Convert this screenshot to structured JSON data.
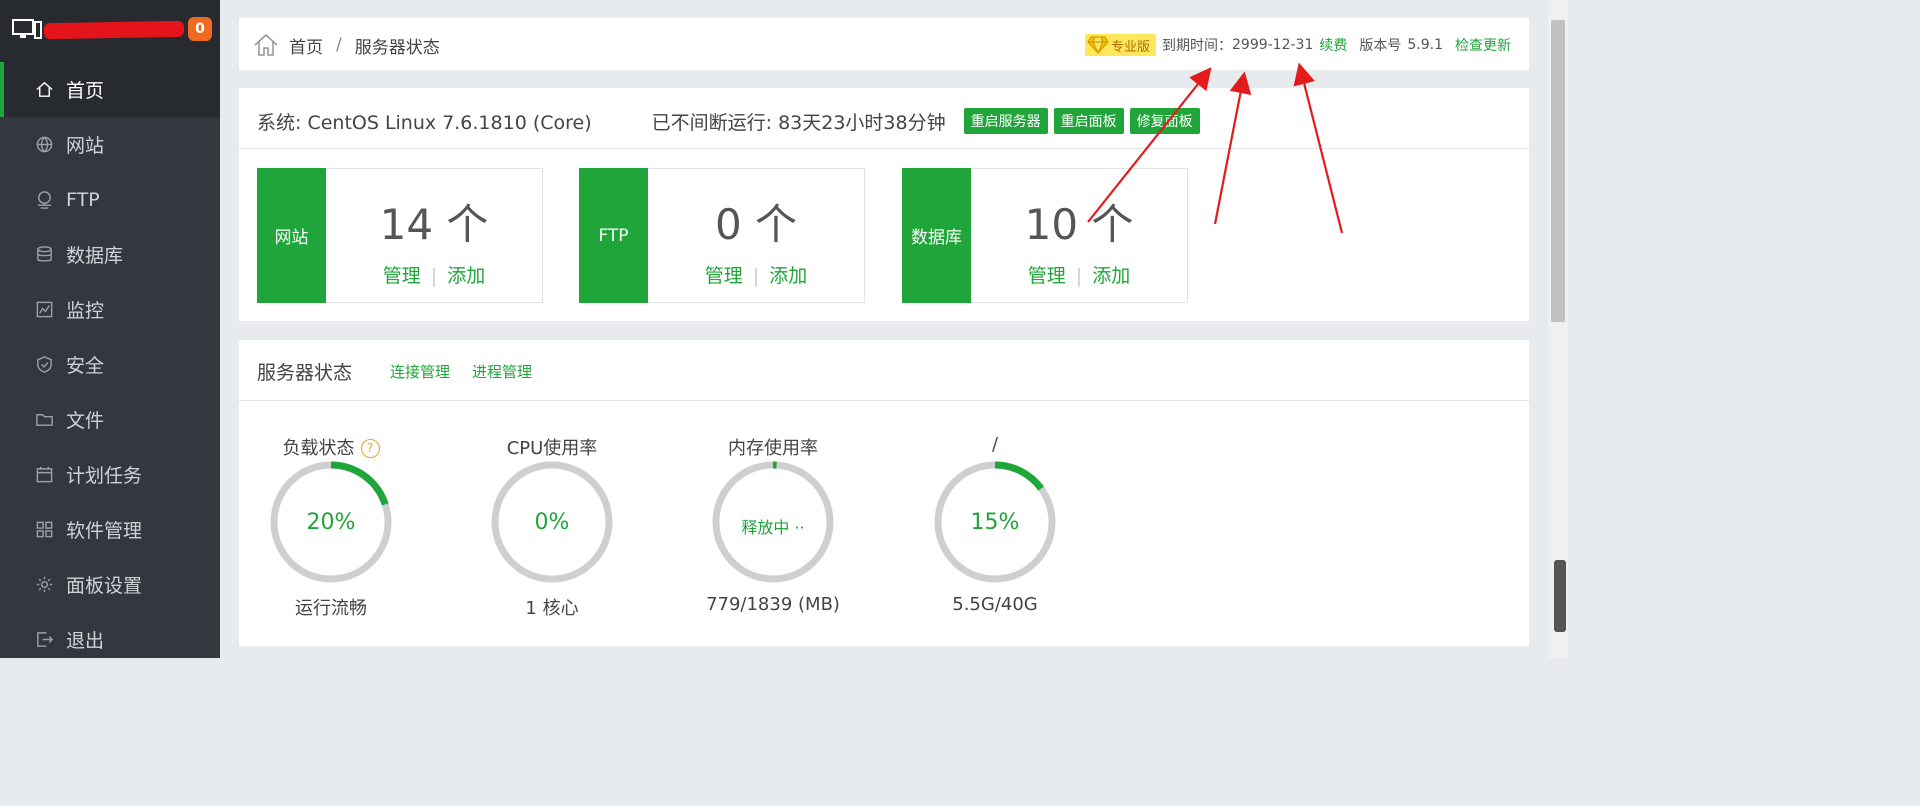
{
  "sidebar": {
    "notification_count": "0",
    "items": [
      {
        "label": "首页",
        "icon": "home-icon",
        "active": true
      },
      {
        "label": "网站",
        "icon": "globe-icon"
      },
      {
        "label": "FTP",
        "icon": "ftp-icon"
      },
      {
        "label": "数据库",
        "icon": "database-icon"
      },
      {
        "label": "监控",
        "icon": "monitor-icon"
      },
      {
        "label": "安全",
        "icon": "shield-icon"
      },
      {
        "label": "文件",
        "icon": "folder-icon"
      },
      {
        "label": "计划任务",
        "icon": "calendar-icon"
      },
      {
        "label": "软件管理",
        "icon": "apps-icon"
      },
      {
        "label": "面板设置",
        "icon": "gear-icon"
      },
      {
        "label": "退出",
        "icon": "logout-icon"
      }
    ]
  },
  "topbar": {
    "breadcrumb": {
      "home": "首页",
      "separator": "/",
      "current": "服务器状态"
    },
    "pro_label": "专业版",
    "expire_label": "到期时间：",
    "expire_date": "2999-12-31",
    "renew": "续费",
    "version_label": "版本号",
    "version": "5.9.1",
    "check_update": "检查更新"
  },
  "system": {
    "os": "系统: CentOS Linux 7.6.1810 (Core)",
    "uptime": "已不间断运行: 83天23小时38分钟",
    "buttons": {
      "restart_server": "重启服务器",
      "restart_panel": "重启面板",
      "repair_panel": "修复面板"
    }
  },
  "cards": [
    {
      "tag": "网站",
      "count": "14 个",
      "manage": "管理",
      "separator": "|",
      "add": "添加"
    },
    {
      "tag": "FTP",
      "count": "0 个",
      "manage": "管理",
      "separator": "|",
      "add": "添加"
    },
    {
      "tag": "数据库",
      "count": "10 个",
      "manage": "管理",
      "separator": "|",
      "add": "添加"
    }
  ],
  "status": {
    "title": "服务器状态",
    "links": {
      "connections": "连接管理",
      "processes": "进程管理"
    },
    "gauges": [
      {
        "label": "负载状态",
        "help": "?",
        "value": "20%",
        "fraction": 0.2,
        "sub": "运行流畅"
      },
      {
        "label": "CPU使用率",
        "value": "0%",
        "fraction": 0.0,
        "sub": "1 核心"
      },
      {
        "label": "内存使用率",
        "value": "释放中 ··",
        "fraction": 0.01,
        "sub": "779/1839 (MB)"
      },
      {
        "label": "/",
        "value": "15%",
        "fraction": 0.15,
        "sub": "5.5G/40G"
      }
    ]
  },
  "colors": {
    "accent": "#20a53a",
    "sidebar_bg": "#32383e",
    "annotation": "#e31b1b"
  }
}
